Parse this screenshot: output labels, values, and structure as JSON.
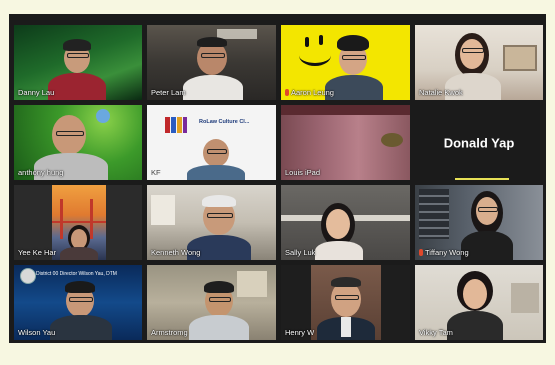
{
  "participants": [
    {
      "name": "Danny Lau",
      "muted": false
    },
    {
      "name": "Peter Lam",
      "muted": false
    },
    {
      "name": "Aaron Leung",
      "muted": true
    },
    {
      "name": "Natalie Kwok",
      "muted": false
    },
    {
      "name": "anthony hung",
      "muted": false
    },
    {
      "name": "KF",
      "muted": false
    },
    {
      "name": "Louis iPad",
      "muted": false
    },
    {
      "name": "Donald Yap",
      "muted": false,
      "video_off": true
    },
    {
      "name": "Yee Ke Har",
      "muted": false
    },
    {
      "name": "Kenneth Wong",
      "muted": false
    },
    {
      "name": "Sally Luk",
      "muted": false
    },
    {
      "name": "Tiffany Wong",
      "muted": true
    },
    {
      "name": "Wilson Yau",
      "muted": false
    },
    {
      "name": "Armstromg",
      "muted": false,
      "active_speaker": true
    },
    {
      "name": "Henry W",
      "muted": false
    },
    {
      "name": "Vikky Tam",
      "muted": false
    }
  ],
  "tile_text": {
    "wilson_banner": "District 00 Director Wilson Yau, DTM",
    "kf_sign": "RoLaw Culture Cl..."
  },
  "colors": {
    "window_bg": "#1b1b1b",
    "page_bg": "#f7f7e1",
    "speaker_highlight": "#e8e257",
    "muted_icon": "#e0482b"
  }
}
